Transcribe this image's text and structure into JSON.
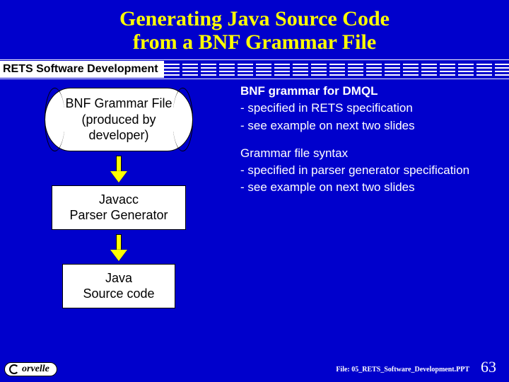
{
  "title_line1": "Generating Java Source Code",
  "title_line2": "from a BNF Grammar File",
  "subtitle": "RETS Software Development",
  "flow": {
    "bnf_l1": "BNF Grammar File",
    "bnf_l2": "(produced by",
    "bnf_l3": "developer)",
    "javacc_l1": "Javacc",
    "javacc_l2": "Parser Generator",
    "src_l1": "Java",
    "src_l2": "Source code"
  },
  "notes": {
    "g1_l1": "BNF grammar for DMQL",
    "g1_l2": "- specified in RETS specification",
    "g1_l3": "- see example on next two slides",
    "g2_l1": "Grammar file syntax",
    "g2_l2": "- specified in parser generator specification",
    "g2_l3": "- see example on next two slides"
  },
  "footer": {
    "logo_text": "orvelle",
    "file_label": "File: 05_RETS_Software_Development.PPT",
    "page": "63"
  }
}
